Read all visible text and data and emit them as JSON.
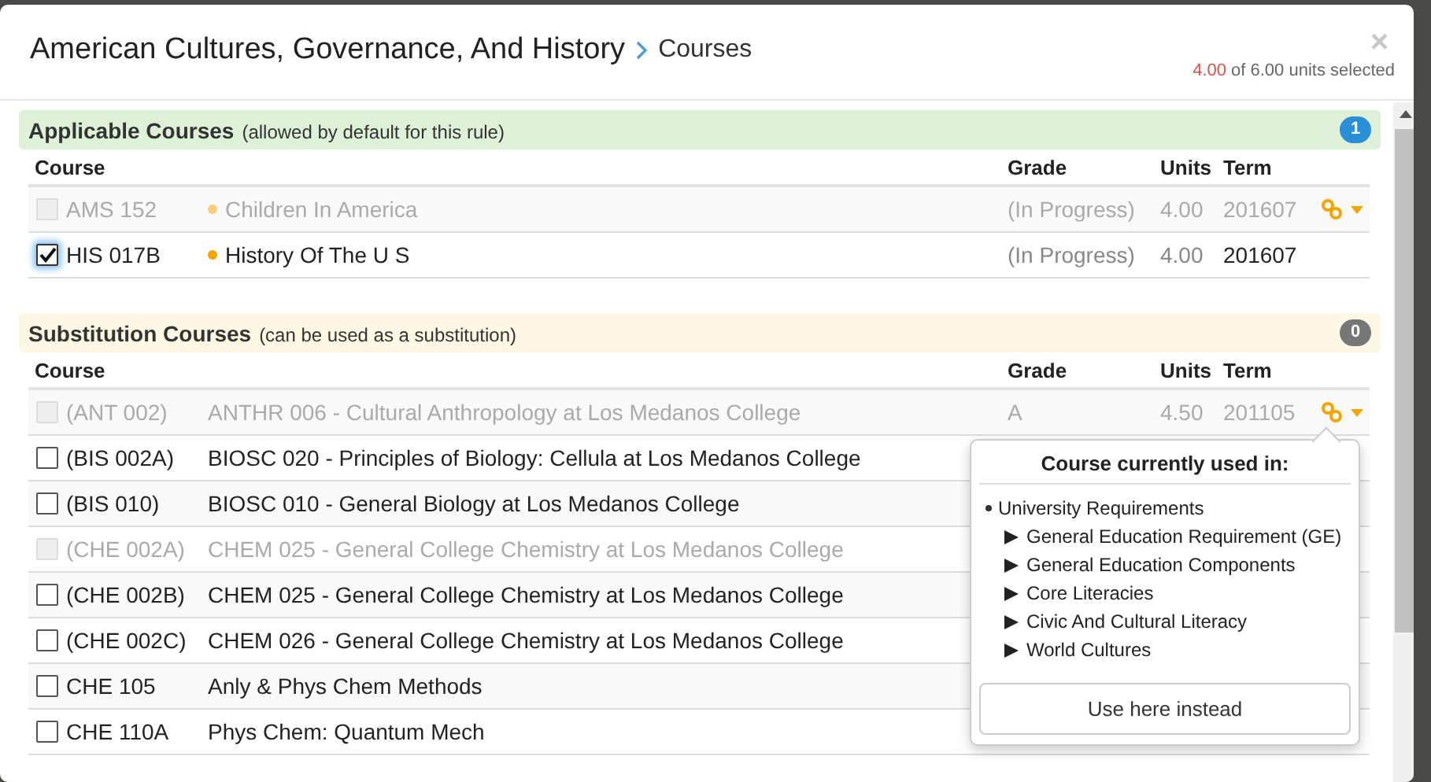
{
  "modal": {
    "title": "American Cultures, Governance, And History",
    "subtitle": "Courses",
    "close": "×",
    "units_selected": "4.00",
    "units_note": "of 6.00 units selected"
  },
  "sections": [
    {
      "kind": "applicable",
      "title": "Applicable Courses",
      "note": "(allowed by default for this rule)",
      "count": "1",
      "columns": [
        "Course",
        "Grade",
        "Units",
        "Term"
      ],
      "rows": [
        {
          "code": "AMS 152",
          "title": "Children In America",
          "grade": "(In Progress)",
          "units": "4.00",
          "term": "201607",
          "checked": false,
          "disabled": true,
          "focused": false,
          "linked": true
        },
        {
          "code": "HIS 017B",
          "title": "History Of The U S",
          "grade": "(In Progress)",
          "units": "4.00",
          "term": "201607",
          "checked": true,
          "disabled": false,
          "focused": true,
          "linked": false
        }
      ]
    },
    {
      "kind": "substitution",
      "title": "Substitution Courses",
      "note": "(can be used as a substitution)",
      "count": "0",
      "columns": [
        "Course",
        "Grade",
        "Units",
        "Term"
      ],
      "rows": [
        {
          "code": "(ANT 002)",
          "title": "ANTHR 006 - Cultural Anthropology at Los Medanos College",
          "grade": "A",
          "units": "4.50",
          "term": "201105",
          "checked": false,
          "disabled": true,
          "focused": false,
          "linked": true,
          "popover": {
            "heading": "Course currently used in:",
            "root": "University Requirements",
            "path": [
              "General Education Requirement (GE)",
              "General Education Components",
              "Core Literacies",
              "Civic And Cultural Literacy",
              "World Cultures"
            ],
            "button": "Use here instead"
          }
        },
        {
          "code": "(BIS 002A)",
          "title": "BIOSC 020 - Principles of Biology: Cellula at Los Medanos College",
          "checked": false,
          "disabled": false,
          "focused": false,
          "linked": false
        },
        {
          "code": "(BIS 010)",
          "title": "BIOSC 010 - General Biology at Los Medanos College",
          "checked": false,
          "disabled": false,
          "focused": false,
          "linked": false
        },
        {
          "code": "(CHE 002A)",
          "title": "CHEM 025 - General College Chemistry at Los Medanos College",
          "checked": false,
          "disabled": true,
          "focused": false,
          "linked": false
        },
        {
          "code": "(CHE 002B)",
          "title": "CHEM 025 - General College Chemistry at Los Medanos College",
          "checked": false,
          "disabled": false,
          "focused": false,
          "linked": false
        },
        {
          "code": "(CHE 002C)",
          "title": "CHEM 026 - General College Chemistry at Los Medanos College",
          "checked": false,
          "disabled": false,
          "focused": false,
          "linked": false
        },
        {
          "code": "CHE 105",
          "title": "Anly & Phys Chem Methods",
          "checked": false,
          "disabled": false,
          "focused": false,
          "linked": false
        },
        {
          "code": "CHE 110A",
          "title": "Phys Chem: Quantum Mech",
          "checked": false,
          "disabled": false,
          "focused": false,
          "linked": false
        }
      ]
    }
  ]
}
